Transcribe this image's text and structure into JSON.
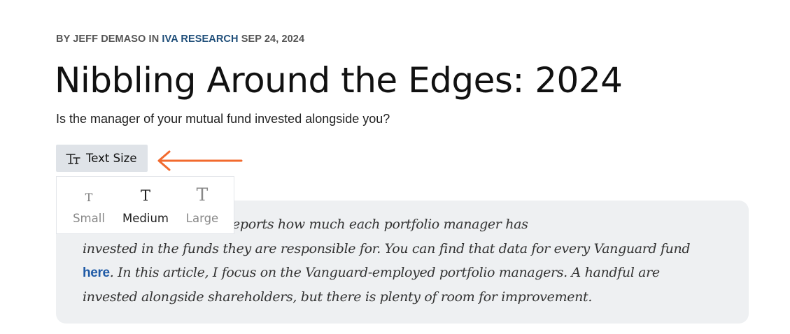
{
  "article": {
    "byline_prefix": "BY JEFF DEMASO IN ",
    "category": "IVA RESEARCH",
    "date": " SEP 24, 2024",
    "title": "Nibbling Around the Edges: 2024",
    "subtitle": "Is the manager of your mutual fund invested alongside you?"
  },
  "text_size": {
    "button_label": "Text Size",
    "options": [
      {
        "glyph": "T",
        "label": "Small"
      },
      {
        "glyph": "T",
        "label": "Medium"
      },
      {
        "glyph": "T",
        "label": "Large"
      }
    ],
    "selected": "Medium"
  },
  "intro": {
    "line1": "Every year, Vanguard reports how much each portfolio manager has",
    "line2": "invested in the funds they are responsible for. You can find that data for every Vanguard fund",
    "link": "here",
    "line3_rest": ". In this article, I focus on the Vanguard-employed portfolio managers. A handful are",
    "line4": "invested alongside shareholders, but there is plenty of room for improvement."
  },
  "colors": {
    "arrow": "#f26a2e",
    "link": "#1f5aa6",
    "category": "#1f4e79",
    "button_bg": "#dfe3e8",
    "quote_bg": "#eef0f2"
  },
  "icons": {
    "text_size": "text-size-icon",
    "annotation": "arrow-left-icon"
  }
}
